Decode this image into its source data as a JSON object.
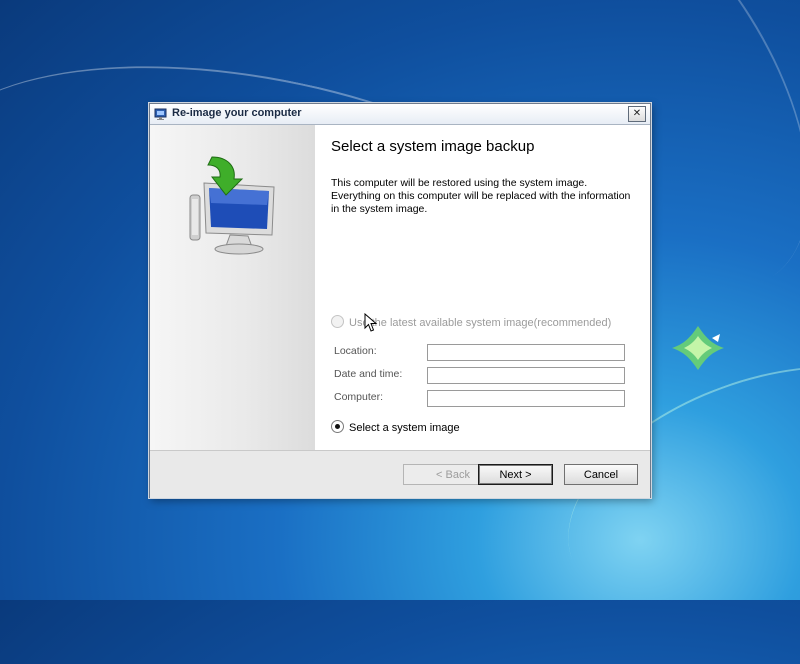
{
  "dialog": {
    "title": "Re-image your computer",
    "close_glyph": "✕",
    "heading": "Select a system image backup",
    "description": "This computer will be restored using the system image. Everything on this computer will be replaced with the information in the system image.",
    "options": {
      "latest_label": "Use the latest available system image(recommended)",
      "latest_enabled": false,
      "select_label": "Select a system image",
      "selected": "select"
    },
    "fields": {
      "location_label": "Location:",
      "location_value": "",
      "datetime_label": "Date and time:",
      "datetime_value": "",
      "computer_label": "Computer:",
      "computer_value": ""
    },
    "buttons": {
      "back": "< Back",
      "next": "Next >",
      "cancel": "Cancel"
    }
  },
  "icons": {
    "title": "window-restore-icon",
    "hero": "computer-restore-icon",
    "cursor": "mouse-pointer-icon",
    "wallpaper_logo": "windows-logo-icon"
  },
  "colors": {
    "desktop_blue": "#1a6fc4",
    "titlebar_text": "#1b2b44",
    "disabled_text": "#9b9b9b"
  }
}
